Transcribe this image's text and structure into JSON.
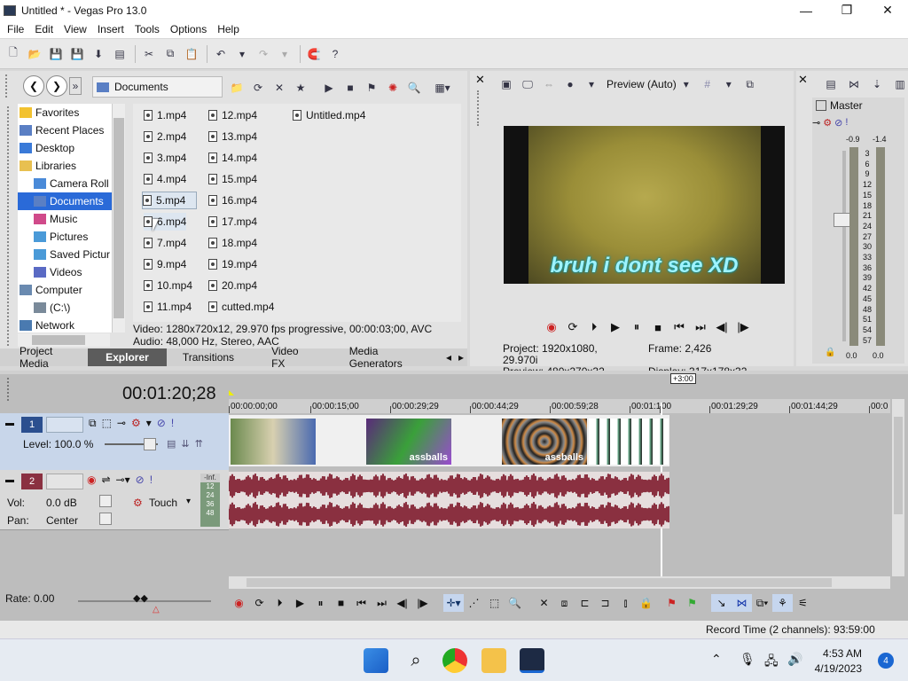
{
  "window": {
    "title": "Untitled * - Vegas Pro 13.0",
    "minimize": "—",
    "maximize": "❐",
    "close": "✕"
  },
  "menu": [
    "File",
    "Edit",
    "View",
    "Insert",
    "Tools",
    "Options",
    "Help"
  ],
  "explorer": {
    "path": "Documents",
    "tree": [
      {
        "label": "Favorites",
        "icon": "star-icon",
        "indent": 0
      },
      {
        "label": "Recent Places",
        "icon": "recent-places-icon",
        "indent": 0
      },
      {
        "label": "Desktop",
        "icon": "desktop-icon",
        "indent": 0
      },
      {
        "label": "Libraries",
        "icon": "libraries-icon",
        "indent": 0
      },
      {
        "label": "Camera Roll",
        "icon": "camera-roll-icon",
        "indent": 1
      },
      {
        "label": "Documents",
        "icon": "documents-icon",
        "indent": 1,
        "selected": true
      },
      {
        "label": "Music",
        "icon": "music-icon",
        "indent": 1
      },
      {
        "label": "Pictures",
        "icon": "pictures-icon",
        "indent": 1
      },
      {
        "label": "Saved Pictur",
        "icon": "saved-pictures-icon",
        "indent": 1
      },
      {
        "label": "Videos",
        "icon": "videos-icon",
        "indent": 1
      },
      {
        "label": "Computer",
        "icon": "computer-icon",
        "indent": 0
      },
      {
        "label": "(C:\\)",
        "icon": "drive-icon",
        "indent": 1
      },
      {
        "label": "Network",
        "icon": "network-icon",
        "indent": 0
      }
    ],
    "files_col1": [
      "1.mp4",
      "2.mp4",
      "3.mp4",
      "4.mp4",
      "5.mp4",
      "6.mp4",
      "7.mp4",
      "9.mp4",
      "10.mp4",
      "11.mp4"
    ],
    "files_col2": [
      "12.mp4",
      "13.mp4",
      "14.mp4",
      "15.mp4",
      "16.mp4",
      "17.mp4",
      "18.mp4",
      "19.mp4",
      "20.mp4",
      "cutted.mp4"
    ],
    "files_col3": [
      "Untitled.mp4"
    ],
    "info_video": "Video: 1280x720x12, 29.970 fps progressive, 00:00:03;00, AVC",
    "info_audio": "Audio: 48,000 Hz, Stereo, AAC",
    "tabs": [
      "Project Media",
      "Explorer",
      "Transitions",
      "Video FX",
      "Media Generators"
    ]
  },
  "preview": {
    "mode": "Preview (Auto)",
    "caption": "bruh i dont see XD",
    "project": "Project:   1920x1080, 29.970i",
    "preview_info": "Preview:  480x270x32, 29.970p",
    "frame": "Frame:      2,426",
    "display": "Display:   317x178x32"
  },
  "master": {
    "label": "Master",
    "peak_left": "-0.9",
    "peak_right": "-1.4",
    "scale": [
      "3",
      "6",
      "9",
      "12",
      "15",
      "18",
      "21",
      "24",
      "27",
      "30",
      "33",
      "36",
      "39",
      "42",
      "45",
      "48",
      "51",
      "54",
      "57"
    ],
    "bottom_left": "0.0",
    "bottom_right": "0.0"
  },
  "timeline": {
    "timecode": "00:01:20;28",
    "offset": "+3:00",
    "ruler": [
      "00:00:00;00",
      "00:00:15;00",
      "00:00:29;29",
      "00:00:44;29",
      "00:00:59;28",
      "00:01:1",
      "00",
      "00:01:29;29",
      "00:01:44;29",
      "00:0"
    ],
    "video_track": {
      "num": "1",
      "level": "Level: 100.0 %"
    },
    "audio_track": {
      "num": "2",
      "vol_label": "Vol:",
      "vol": "0.0 dB",
      "pan_label": "Pan:",
      "pan": "Center",
      "mode": "Touch",
      "meter_top": "-Inf.",
      "meter_scale": [
        "12",
        "24",
        "36",
        "48"
      ]
    },
    "clip_labels": [
      "assballs",
      "assballs"
    ],
    "rate": "Rate: 0.00"
  },
  "status": {
    "record_time": "Record Time (2 channels): 93:59:00"
  },
  "taskbar": {
    "time": "4:53 AM",
    "date": "4/19/2023",
    "notifications": "4"
  },
  "colors": {
    "accent": "#1a67d2",
    "audio_clip": "#8a3040",
    "selected_tab": "#5c5c5c"
  }
}
